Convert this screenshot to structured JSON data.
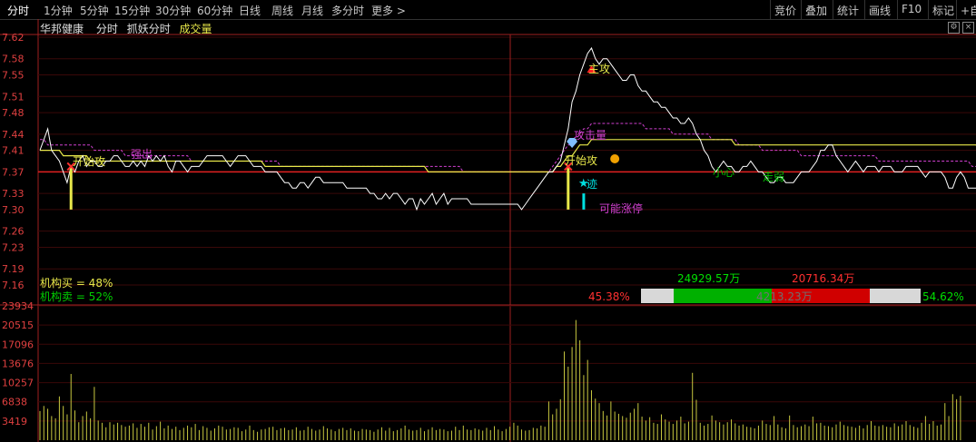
{
  "toolbar": {
    "tabs": [
      "分时",
      "1分钟",
      "5分钟",
      "15分钟",
      "30分钟",
      "60分钟",
      "日线",
      "周线",
      "月线",
      "多分时",
      "更多 >"
    ],
    "right": [
      "竞价",
      "叠加",
      "统计",
      "画线",
      "F10",
      "标记",
      "+自"
    ]
  },
  "info": {
    "stock_name": "华邦健康",
    "mode": "分时",
    "indicator": "抓妖分时",
    "volume_label": "成交量"
  },
  "colors": {
    "price_line": "#ffffff",
    "avg_line": "#e8e84a",
    "ma_dashed": "#d040d0",
    "axis": "#e04040",
    "volume": "#c8c840",
    "green": "#00c000",
    "red": "#e00000"
  },
  "institution": {
    "buy_text": "机构买 = 48%",
    "sell_text": "机构卖 = 52%",
    "buy_amount": "24929.57万",
    "sell_amount": "20716.34万",
    "left_pct": "45.38%",
    "right_pct": "54.62%",
    "middle_amount": "4213.23万",
    "buy_fraction": 0.5
  },
  "annotations": {
    "a1": "开始攻",
    "a2": "强出",
    "a3": "主攻",
    "a4": "攻击量",
    "a5": "开始攻",
    "a6": "迹",
    "a7": "可能涨停",
    "a8": "小心",
    "a9": "走弱"
  },
  "chart_data": [
    {
      "type": "line",
      "name": "price",
      "y_ticks": [
        "7.62",
        "7.58",
        "7.55",
        "7.51",
        "7.48",
        "7.44",
        "7.41",
        "7.37",
        "7.33",
        "7.30",
        "7.26",
        "7.23",
        "7.19",
        "7.16"
      ],
      "ylim": [
        7.16,
        7.62
      ],
      "ref_price": 7.37,
      "price": [
        7.41,
        7.43,
        7.45,
        7.41,
        7.4,
        7.39,
        7.37,
        7.35,
        7.38,
        7.37,
        7.39,
        7.4,
        7.38,
        7.39,
        7.39,
        7.38,
        7.38,
        7.39,
        7.39,
        7.4,
        7.4,
        7.39,
        7.38,
        7.38,
        7.39,
        7.38,
        7.39,
        7.38,
        7.4,
        7.39,
        7.4,
        7.39,
        7.4,
        7.38,
        7.37,
        7.39,
        7.39,
        7.38,
        7.37,
        7.38,
        7.38,
        7.38,
        7.39,
        7.4,
        7.4,
        7.4,
        7.4,
        7.4,
        7.39,
        7.38,
        7.39,
        7.4,
        7.4,
        7.4,
        7.39,
        7.38,
        7.38,
        7.38,
        7.37,
        7.37,
        7.37,
        7.37,
        7.36,
        7.35,
        7.35,
        7.34,
        7.34,
        7.35,
        7.35,
        7.34,
        7.35,
        7.36,
        7.36,
        7.35,
        7.35,
        7.35,
        7.35,
        7.35,
        7.35,
        7.34,
        7.34,
        7.34,
        7.34,
        7.34,
        7.34,
        7.33,
        7.33,
        7.32,
        7.32,
        7.33,
        7.32,
        7.33,
        7.33,
        7.32,
        7.31,
        7.32,
        7.32,
        7.3,
        7.32,
        7.31,
        7.32,
        7.33,
        7.31,
        7.32,
        7.33,
        7.31,
        7.32,
        7.32,
        7.32,
        7.32,
        7.32,
        7.31,
        7.31,
        7.31,
        7.31,
        7.31,
        7.31,
        7.31,
        7.31,
        7.31,
        7.31,
        7.31,
        7.31,
        7.31,
        7.3,
        7.31,
        7.32,
        7.33,
        7.34,
        7.35,
        7.36,
        7.37,
        7.37,
        7.38,
        7.39,
        7.42,
        7.45,
        7.5,
        7.52,
        7.55,
        7.57,
        7.59,
        7.6,
        7.58,
        7.57,
        7.58,
        7.58,
        7.57,
        7.56,
        7.55,
        7.54,
        7.54,
        7.55,
        7.55,
        7.53,
        7.52,
        7.52,
        7.51,
        7.5,
        7.5,
        7.49,
        7.49,
        7.48,
        7.47,
        7.47,
        7.46,
        7.46,
        7.47,
        7.46,
        7.44,
        7.43,
        7.41,
        7.4,
        7.38,
        7.37,
        7.38,
        7.39,
        7.38,
        7.38,
        7.37,
        7.37,
        7.38,
        7.38,
        7.39,
        7.38,
        7.37,
        7.37,
        7.36,
        7.35,
        7.35,
        7.36,
        7.36,
        7.35,
        7.35,
        7.35,
        7.36,
        7.37,
        7.37,
        7.37,
        7.38,
        7.39,
        7.41,
        7.41,
        7.42,
        7.42,
        7.4,
        7.39,
        7.38,
        7.37,
        7.38,
        7.39,
        7.38,
        7.37,
        7.38,
        7.38,
        7.38,
        7.37,
        7.38,
        7.38,
        7.38,
        7.37,
        7.37,
        7.37,
        7.38,
        7.38,
        7.38,
        7.38,
        7.37,
        7.36,
        7.37,
        7.37,
        7.37,
        7.37,
        7.36,
        7.34,
        7.34,
        7.36,
        7.37,
        7.36,
        7.34,
        7.34,
        7.34
      ],
      "avg": [
        7.41,
        7.41,
        7.41,
        7.41,
        7.41,
        7.41,
        7.4,
        7.4,
        7.4,
        7.4,
        7.4,
        7.4,
        7.4,
        7.39,
        7.39,
        7.39,
        7.39,
        7.39,
        7.39,
        7.39,
        7.39,
        7.39,
        7.39,
        7.39,
        7.39,
        7.39,
        7.39,
        7.39,
        7.39,
        7.39,
        7.39,
        7.39,
        7.39,
        7.39,
        7.39,
        7.39,
        7.39,
        7.39,
        7.39,
        7.39,
        7.39,
        7.39,
        7.39,
        7.39,
        7.39,
        7.39,
        7.39,
        7.39,
        7.39,
        7.39,
        7.39,
        7.39,
        7.39,
        7.39,
        7.39,
        7.39,
        7.39,
        7.39,
        7.38,
        7.38,
        7.38,
        7.38,
        7.38,
        7.38,
        7.38,
        7.38,
        7.38,
        7.38,
        7.38,
        7.38,
        7.38,
        7.38,
        7.38,
        7.38,
        7.38,
        7.38,
        7.38,
        7.38,
        7.38,
        7.38,
        7.38,
        7.38,
        7.38,
        7.38,
        7.38,
        7.38,
        7.38,
        7.38,
        7.38,
        7.38,
        7.38,
        7.38,
        7.38,
        7.38,
        7.38,
        7.38,
        7.38,
        7.38,
        7.38,
        7.38,
        7.37,
        7.37,
        7.37,
        7.37,
        7.37,
        7.37,
        7.37,
        7.37,
        7.37,
        7.37,
        7.37,
        7.37,
        7.37,
        7.37,
        7.37,
        7.37,
        7.37,
        7.37,
        7.37,
        7.37,
        7.37,
        7.37,
        7.37,
        7.37,
        7.37,
        7.37,
        7.37,
        7.37,
        7.37,
        7.37,
        7.37,
        7.37,
        7.37,
        7.38,
        7.38,
        7.39,
        7.4,
        7.4,
        7.41,
        7.42,
        7.42,
        7.42,
        7.43,
        7.43,
        7.43,
        7.43,
        7.43,
        7.43,
        7.43,
        7.43,
        7.43,
        7.43,
        7.43,
        7.43,
        7.43,
        7.43,
        7.43,
        7.43,
        7.43,
        7.43,
        7.43,
        7.43,
        7.43,
        7.43,
        7.43,
        7.43,
        7.43,
        7.43,
        7.43,
        7.43,
        7.43,
        7.43,
        7.43,
        7.43,
        7.43,
        7.43,
        7.43,
        7.43,
        7.43,
        7.42,
        7.42,
        7.42,
        7.42,
        7.42,
        7.42,
        7.42,
        7.42,
        7.42,
        7.42,
        7.42,
        7.42,
        7.42,
        7.42,
        7.42,
        7.42,
        7.42,
        7.42,
        7.42,
        7.42,
        7.42,
        7.42,
        7.42,
        7.42,
        7.42,
        7.42,
        7.42,
        7.42,
        7.42,
        7.42,
        7.42,
        7.42,
        7.42,
        7.42,
        7.42,
        7.42,
        7.42,
        7.42,
        7.42,
        7.42,
        7.42,
        7.42,
        7.42,
        7.42,
        7.42,
        7.42,
        7.42,
        7.42,
        7.42,
        7.42,
        7.42,
        7.42,
        7.42,
        7.42,
        7.42,
        7.42,
        7.42,
        7.42,
        7.42,
        7.42,
        7.42,
        7.42,
        7.42,
        7.41,
        7.41
      ],
      "ma": [
        7.43,
        7.43,
        7.42,
        7.42,
        7.42,
        7.42,
        7.42,
        7.42,
        7.42,
        7.42,
        7.42,
        7.42,
        7.42,
        7.42,
        7.41,
        7.41,
        7.41,
        7.41,
        7.41,
        7.41,
        7.41,
        7.41,
        7.4,
        7.4,
        7.4,
        7.4,
        7.4,
        7.4,
        7.4,
        7.4,
        7.4,
        7.4,
        7.4,
        7.4,
        7.4,
        7.4,
        7.4,
        7.4,
        7.4,
        7.39,
        7.39,
        7.39,
        7.39,
        7.39,
        7.39,
        7.39,
        7.39,
        7.39,
        7.39,
        7.39,
        7.39,
        7.39,
        7.39,
        7.39,
        7.39,
        7.39,
        7.39,
        7.39,
        7.39,
        7.39,
        7.39,
        7.39,
        7.38,
        7.38,
        7.38,
        7.38,
        7.38,
        7.38,
        7.38,
        7.38,
        7.38,
        7.38,
        7.38,
        7.38,
        7.38,
        7.38,
        7.38,
        7.38,
        7.38,
        7.38,
        7.38,
        7.38,
        7.38,
        7.38,
        7.38,
        7.38,
        7.38,
        7.38,
        7.38,
        7.38,
        7.38,
        7.38,
        7.38,
        7.38,
        7.38,
        7.38,
        7.38,
        7.38,
        7.38,
        7.38,
        7.38,
        7.38,
        7.38,
        7.38,
        7.38,
        7.38,
        7.38,
        7.38,
        7.38,
        7.37,
        7.37,
        7.37,
        7.37,
        7.37,
        7.37,
        7.37,
        7.37,
        7.37,
        7.37,
        7.37,
        7.37,
        7.37,
        7.37,
        7.37,
        7.37,
        7.37,
        7.37,
        7.37,
        7.37,
        7.37,
        7.37,
        7.37,
        7.38,
        7.39,
        7.4,
        7.41,
        7.42,
        7.42,
        7.43,
        7.44,
        7.45,
        7.45,
        7.46,
        7.46,
        7.46,
        7.46,
        7.46,
        7.46,
        7.46,
        7.46,
        7.46,
        7.46,
        7.46,
        7.46,
        7.46,
        7.46,
        7.45,
        7.45,
        7.45,
        7.45,
        7.45,
        7.45,
        7.45,
        7.44,
        7.44,
        7.44,
        7.44,
        7.44,
        7.44,
        7.44,
        7.44,
        7.44,
        7.44,
        7.43,
        7.43,
        7.43,
        7.43,
        7.43,
        7.43,
        7.43,
        7.42,
        7.42,
        7.42,
        7.42,
        7.42,
        7.42,
        7.41,
        7.41,
        7.41,
        7.41,
        7.41,
        7.41,
        7.41,
        7.41,
        7.41,
        7.41,
        7.4,
        7.4,
        7.4,
        7.4,
        7.4,
        7.4,
        7.4,
        7.4,
        7.4,
        7.4,
        7.4,
        7.4,
        7.4,
        7.4,
        7.4,
        7.4,
        7.4,
        7.4,
        7.4,
        7.4,
        7.39,
        7.39,
        7.39,
        7.39,
        7.39,
        7.39,
        7.39,
        7.39,
        7.39,
        7.39,
        7.39,
        7.39,
        7.39,
        7.39,
        7.39,
        7.39,
        7.39,
        7.39,
        7.39,
        7.39,
        7.39,
        7.39,
        7.39,
        7.39,
        7.38,
        7.38,
        7.38,
        7.38,
        7.38
      ],
      "signals": [
        {
          "i": 8,
          "bar_low": 7.3,
          "bar_high": 7.38,
          "color": "#e8e84a"
        },
        {
          "i": 136,
          "bar_low": 7.3,
          "bar_high": 7.38,
          "color": "#e8e84a"
        },
        {
          "i": 140,
          "bar_low": 7.3,
          "bar_high": 7.33,
          "color": "#00e0e0"
        }
      ]
    },
    {
      "type": "bar",
      "name": "volume",
      "y_ticks": [
        "23934",
        "20515",
        "17096",
        "13676",
        "10257",
        "6838",
        "3419"
      ],
      "ylim": [
        0,
        23934
      ],
      "values": [
        5200,
        6100,
        5600,
        4300,
        3900,
        7800,
        6100,
        4600,
        11800,
        5300,
        3200,
        4300,
        5100,
        3900,
        9500,
        3500,
        3100,
        2300,
        3200,
        2800,
        3100,
        2700,
        2400,
        2600,
        3000,
        2200,
        2900,
        2400,
        3100,
        1900,
        2500,
        3300,
        2100,
        2600,
        2000,
        2400,
        1800,
        2200,
        2600,
        2300,
        2900,
        1800,
        2500,
        2200,
        1700,
        2100,
        2600,
        2400,
        1900,
        2000,
        2300,
        2200,
        1600,
        1900,
        2600,
        1800,
        1500,
        1900,
        2000,
        2300,
        2400,
        1800,
        2100,
        2200,
        1800,
        1900,
        2300,
        1700,
        1800,
        2400,
        2000,
        1700,
        1900,
        2500,
        2100,
        1900,
        1600,
        2000,
        2200,
        1800,
        2100,
        1700,
        1600,
        2000,
        1900,
        1800,
        1500,
        1900,
        2300,
        1700,
        2200,
        1600,
        1800,
        2100,
        2600,
        1900,
        1700,
        1800,
        2200,
        1600,
        1900,
        2300,
        1800,
        2000,
        1900,
        1600,
        1700,
        2400,
        1800,
        2600,
        1900,
        1800,
        2100,
        1900,
        1700,
        2200,
        1800,
        2500,
        1900,
        1600,
        2000,
        2400,
        3100,
        2600,
        1900,
        1700,
        1800,
        2200,
        2100,
        2600,
        2400,
        6900,
        4600,
        5600,
        7300,
        15800,
        13100,
        16600,
        21400,
        17800,
        11600,
        14300,
        8900,
        7400,
        6600,
        5200,
        4400,
        6900,
        5100,
        4700,
        4300,
        4000,
        4900,
        5600,
        6600,
        4200,
        3500,
        4100,
        3100,
        2900,
        4600,
        3700,
        3300,
        2900,
        3500,
        4200,
        3000,
        3300,
        12000,
        7200,
        3100,
        2600,
        2900,
        4400,
        3500,
        3200,
        2800,
        3200,
        3700,
        3000,
        2600,
        2800,
        2400,
        2300,
        2100,
        2600,
        3500,
        2900,
        2700,
        4300,
        2800,
        2300,
        2100,
        4400,
        2700,
        2300,
        2500,
        2800,
        2500,
        4200,
        3000,
        3100,
        2600,
        2500,
        2300,
        2800,
        3300,
        2700,
        2500,
        2400,
        2200,
        2600,
        2100,
        2700,
        3400,
        2600,
        2500,
        2700,
        2400,
        2300,
        3000,
        2500,
        2800,
        3400,
        2700,
        2400,
        2200,
        3100,
        4300,
        2900,
        3400,
        2600,
        2800,
        6600,
        4300,
        8200,
        7300,
        7900
      ]
    }
  ]
}
